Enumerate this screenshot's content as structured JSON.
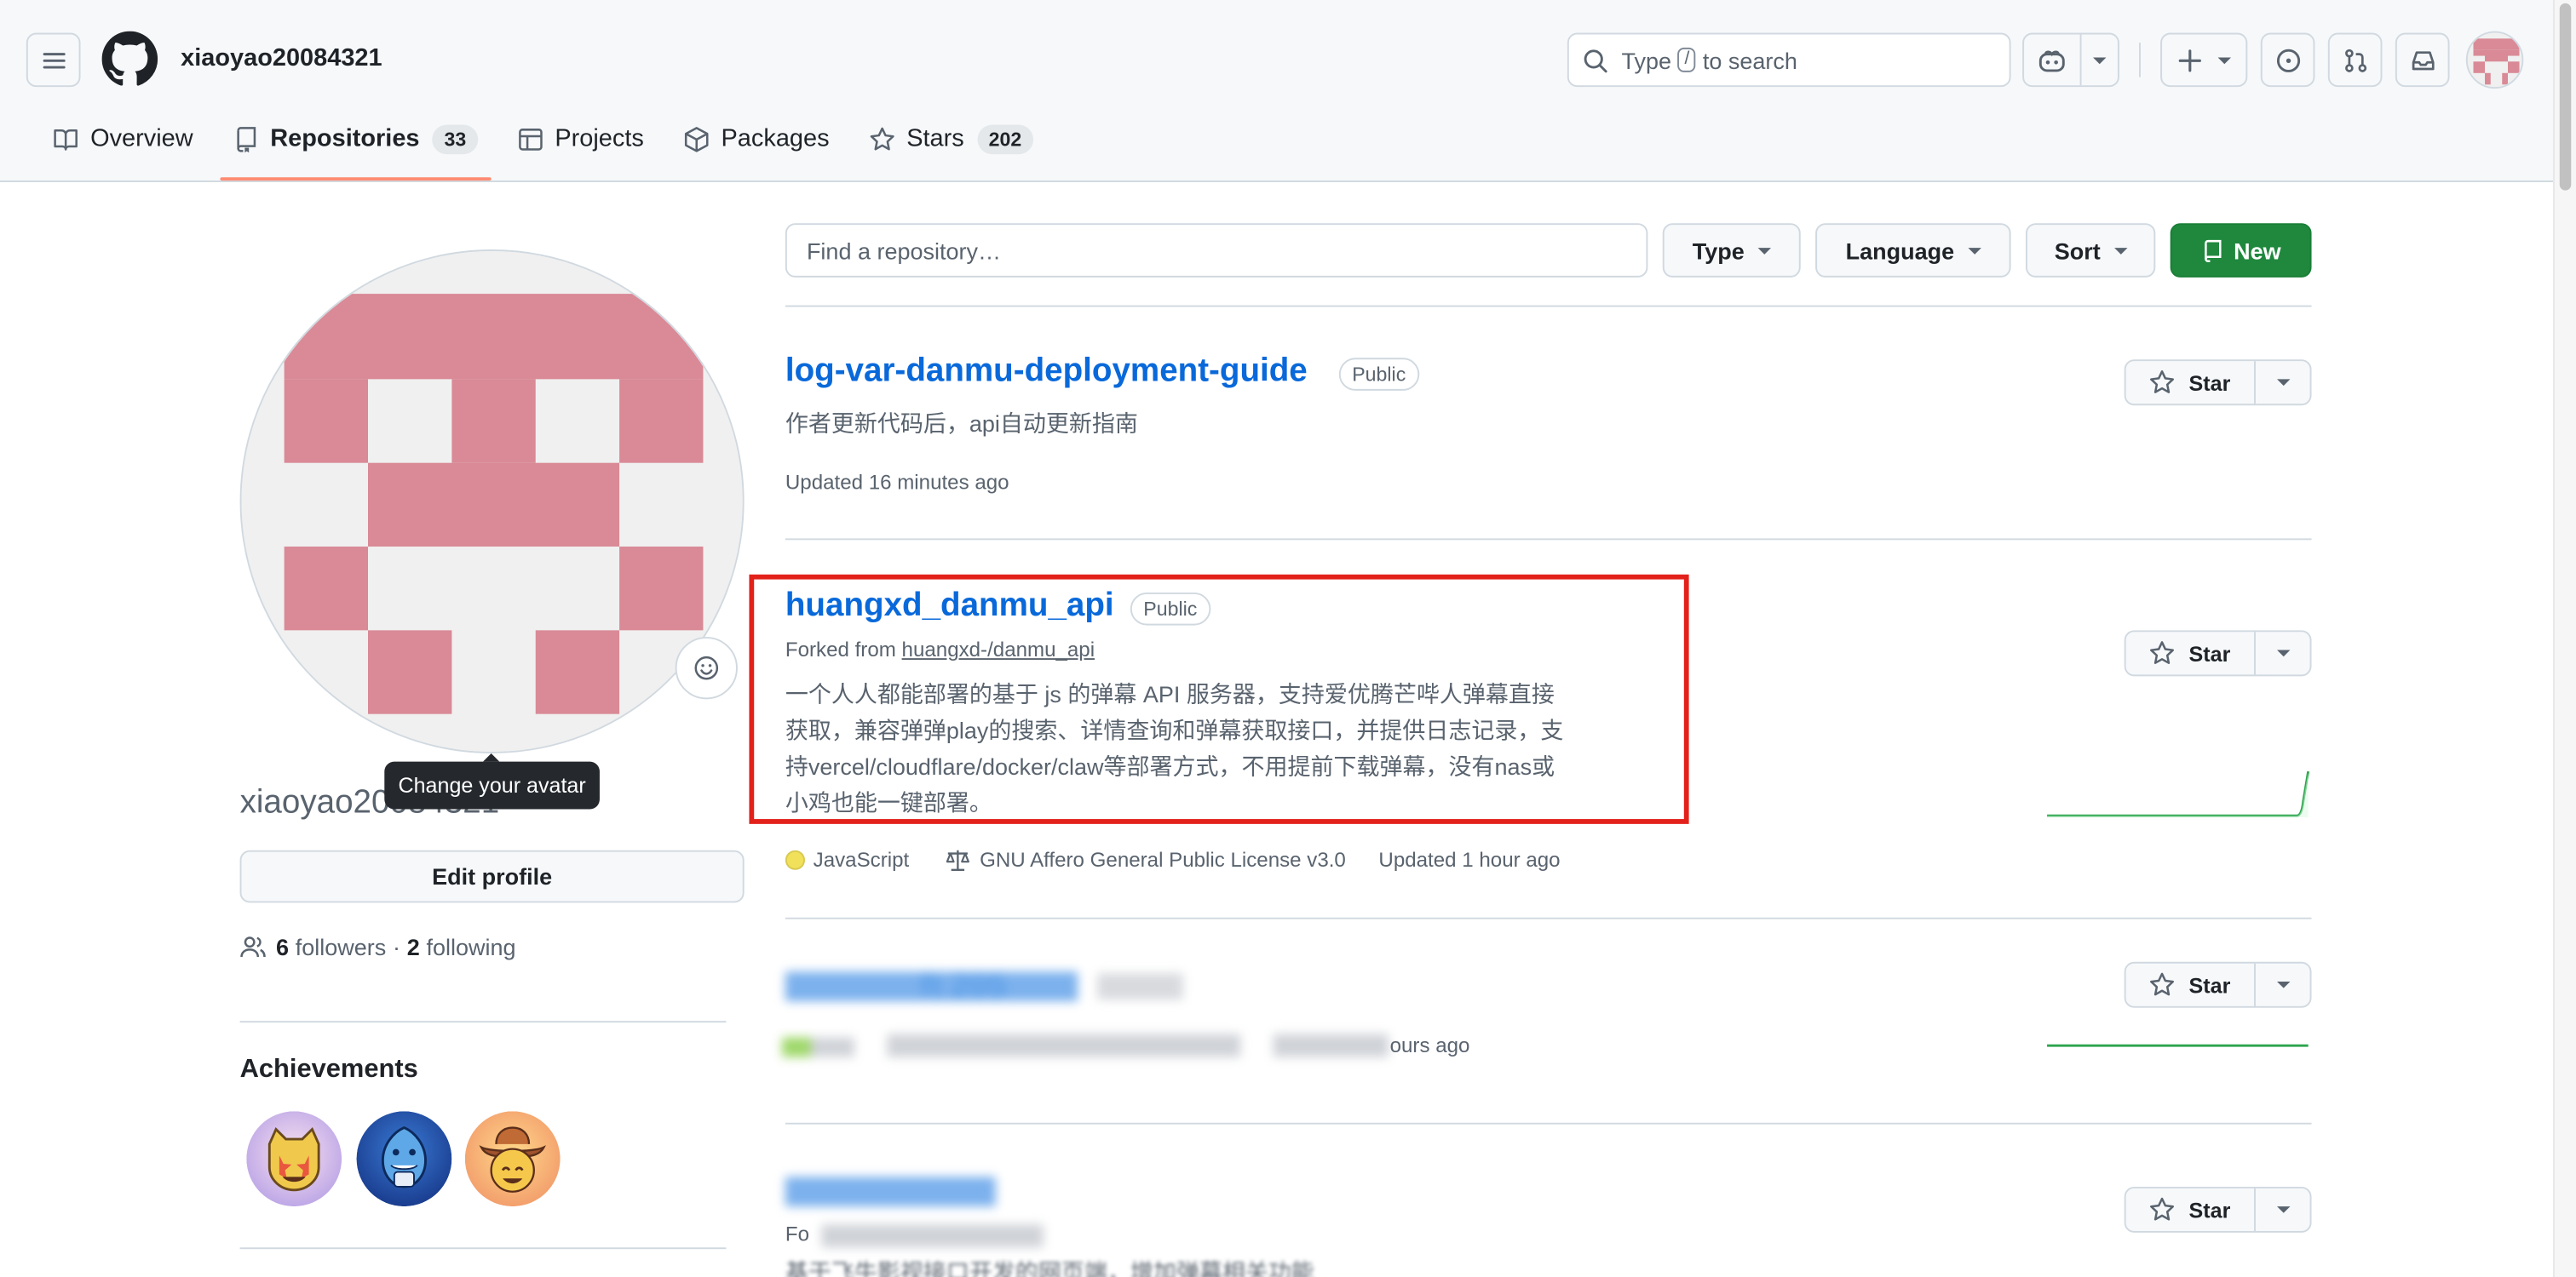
{
  "header": {
    "username": "xiaoyao20084321",
    "search_prefix": "Type",
    "search_key": "/",
    "search_suffix": "to search"
  },
  "tabs": [
    {
      "label": "Overview",
      "icon": "book-icon"
    },
    {
      "label": "Repositories",
      "count": "33",
      "icon": "repo-icon",
      "active": true
    },
    {
      "label": "Projects",
      "icon": "table-icon"
    },
    {
      "label": "Packages",
      "icon": "package-icon"
    },
    {
      "label": "Stars",
      "count": "202",
      "icon": "star-icon"
    }
  ],
  "sidebar": {
    "tooltip": "Change your avatar",
    "username": "xiaoyao20084321",
    "edit_profile": "Edit profile",
    "followers_count": "6",
    "followers_label": "followers",
    "separator": "·",
    "following_count": "2",
    "following_label": "following",
    "achievements_title": "Achievements"
  },
  "filters": {
    "find_placeholder": "Find a repository…",
    "type": "Type",
    "language": "Language",
    "sort": "Sort",
    "new": "New"
  },
  "repos": [
    {
      "name": "log-var-danmu-deployment-guide",
      "visibility": "Public",
      "description": "作者更新代码后，api自动更新指南",
      "updated": "Updated 16 minutes ago",
      "star_label": "Star"
    },
    {
      "name": "huangxd_danmu_api",
      "visibility": "Public",
      "forked_prefix": "Forked from",
      "forked_from": "huangxd-/danmu_api",
      "description_lines": [
        "一个人人都能部署的基于 js 的弹幕 API 服务器，支持爱优腾芒哔人弹幕直接",
        "获取，兼容弹弹play的搜索、详情查询和弹幕获取接口，并提供日志记录，支",
        "持vercel/cloudflare/docker/claw等部署方式，不用提前下载弹幕，没有nas或",
        "小鸡也能一键部署。"
      ],
      "language": "JavaScript",
      "language_color": "#f1e05a",
      "license": "GNU Affero General Public License v3.0",
      "updated": "Updated 1 hour ago",
      "star_label": "Star"
    },
    {
      "name_partial": "ft 205",
      "updated_partial": "ours ago",
      "star_label": "Star"
    },
    {
      "forked_partial": "Fo",
      "description_partial": "基于飞牛影视接口开发的网页端，增加弹幕相关功能",
      "star_label": "Star"
    }
  ],
  "colors": {
    "link": "#0969da",
    "new_button": "#1f883d",
    "tab_underline": "#fd8c73",
    "highlight_box": "#e3211b",
    "avatar_pink": "#d98a96"
  }
}
